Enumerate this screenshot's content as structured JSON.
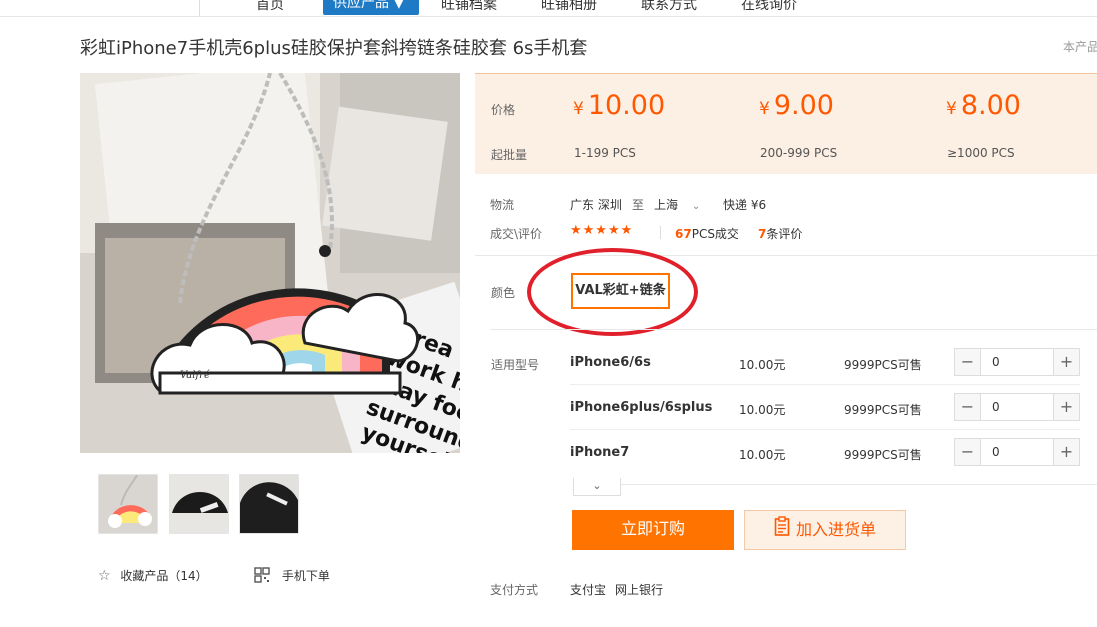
{
  "nav": {
    "items": [
      "首页",
      "旺铺档案",
      "旺铺相册",
      "联系方式",
      "在线询价"
    ],
    "active": "供应产品 ▼"
  },
  "product": {
    "title": "彩虹iPhone7手机壳6plus硅胶保护套斜挎链条硅胶套 6s手机套",
    "corner_note": "本产品"
  },
  "gallery": {
    "thumb_count": 3,
    "favorite_label": "收藏产品（14）",
    "mobile_order_label": "手机下单"
  },
  "pricing": {
    "price_label": "价格",
    "moq_label": "起批量",
    "currency": "¥",
    "tiers": [
      {
        "price": "10.00",
        "range": "1-199 PCS"
      },
      {
        "price": "9.00",
        "range": "200-999 PCS"
      },
      {
        "price": "8.00",
        "range": "≥1000 PCS"
      }
    ]
  },
  "logistics": {
    "label": "物流",
    "from": "广东 深圳",
    "to_word": "至",
    "to": "上海",
    "express": "快递 ¥6"
  },
  "rating": {
    "label": "成交\\评价",
    "stars": "★★★★★",
    "deals_count": "67",
    "deals_suffix": "PCS成交",
    "reviews_count": "7",
    "reviews_suffix": "条评价"
  },
  "color": {
    "label": "颜色",
    "option": "VAL彩虹+链条"
  },
  "models": {
    "label": "适用型号",
    "rows": [
      {
        "name": "iPhone6/6s",
        "price": "10.00元",
        "stock": "9999PCS可售",
        "qty": "0"
      },
      {
        "name": "iPhone6plus/6splus",
        "price": "10.00元",
        "stock": "9999PCS可售",
        "qty": "0"
      },
      {
        "name": "iPhone7",
        "price": "10.00元",
        "stock": "9999PCS可售",
        "qty": "0"
      }
    ]
  },
  "actions": {
    "buy_now": "立即订购",
    "add_cart": "加入进货单"
  },
  "payment": {
    "label": "支付方式",
    "alipay": "支付宝",
    "bank": "网上银行"
  },
  "colors": {
    "accent": "#ff7300",
    "price": "#ff5800",
    "nav_active": "#1f7ac6",
    "annotation": "#e0202a"
  }
}
